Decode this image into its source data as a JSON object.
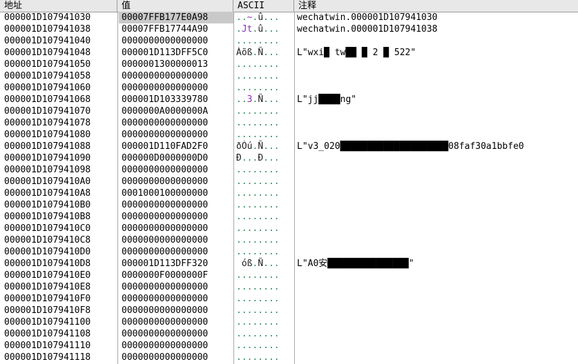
{
  "columns": {
    "address": "地址",
    "value": "值",
    "ascii": "ASCII",
    "comment": "注释"
  },
  "rows": [
    {
      "addr": "000001D107941030",
      "val": "00007FFB177E0A98",
      "ascii": [
        {
          "t": "..",
          "c": "dot"
        },
        {
          "t": "~",
          "c": "hl"
        },
        {
          "t": ".",
          "c": "dot"
        },
        {
          "t": "û",
          "c": "plain"
        },
        {
          "t": "...",
          "c": "dot"
        }
      ],
      "comment": "wechatwin.000001D107941030",
      "selected": true
    },
    {
      "addr": "000001D107941038",
      "val": "00007FFB17744A90",
      "ascii": [
        {
          "t": ".",
          "c": "dot"
        },
        {
          "t": "Jt",
          "c": "hl"
        },
        {
          "t": ".",
          "c": "dot"
        },
        {
          "t": "û",
          "c": "plain"
        },
        {
          "t": "...",
          "c": "dot"
        }
      ],
      "comment": "wechatwin.000001D107941038"
    },
    {
      "addr": "000001D107941040",
      "val": "0000000000000000",
      "ascii": [
        {
          "t": "........",
          "c": "dot"
        }
      ],
      "comment": ""
    },
    {
      "addr": "000001D107941048",
      "val": "000001D113DFF5C0",
      "ascii": [
        {
          "t": "Àõß",
          "c": "plain"
        },
        {
          "t": ".",
          "c": "dot"
        },
        {
          "t": "Ñ",
          "c": "plain"
        },
        {
          "t": "...",
          "c": "dot"
        }
      ],
      "comment": "L\"wxi█ tw██ █ 2 █ 522\""
    },
    {
      "addr": "000001D107941050",
      "val": "0000001300000013",
      "ascii": [
        {
          "t": "........",
          "c": "dot"
        }
      ],
      "comment": ""
    },
    {
      "addr": "000001D107941058",
      "val": "0000000000000000",
      "ascii": [
        {
          "t": "........",
          "c": "dot"
        }
      ],
      "comment": ""
    },
    {
      "addr": "000001D107941060",
      "val": "0000000000000000",
      "ascii": [
        {
          "t": "........",
          "c": "dot"
        }
      ],
      "comment": ""
    },
    {
      "addr": "000001D107941068",
      "val": "000001D103339780",
      "ascii": [
        {
          "t": "..",
          "c": "dot"
        },
        {
          "t": "3",
          "c": "hl"
        },
        {
          "t": ".",
          "c": "dot"
        },
        {
          "t": "Ñ",
          "c": "plain"
        },
        {
          "t": "...",
          "c": "dot"
        }
      ],
      "comment": "L\"jj████ng\""
    },
    {
      "addr": "000001D107941070",
      "val": "0000000A0000000A",
      "ascii": [
        {
          "t": "........",
          "c": "dot"
        }
      ],
      "comment": ""
    },
    {
      "addr": "000001D107941078",
      "val": "0000000000000000",
      "ascii": [
        {
          "t": "........",
          "c": "dot"
        }
      ],
      "comment": ""
    },
    {
      "addr": "000001D107941080",
      "val": "0000000000000000",
      "ascii": [
        {
          "t": "........",
          "c": "dot"
        }
      ],
      "comment": ""
    },
    {
      "addr": "000001D107941088",
      "val": "000001D110FAD2F0",
      "ascii": [
        {
          "t": "ðÒú",
          "c": "plain"
        },
        {
          "t": ".",
          "c": "dot"
        },
        {
          "t": "Ñ",
          "c": "plain"
        },
        {
          "t": "...",
          "c": "dot"
        }
      ],
      "comment": "L\"v3_020████████████████████08faf30a1bbfe0"
    },
    {
      "addr": "000001D107941090",
      "val": "000000D0000000D0",
      "ascii": [
        {
          "t": "Ð",
          "c": "plain"
        },
        {
          "t": "...",
          "c": "dot"
        },
        {
          "t": "Ð",
          "c": "plain"
        },
        {
          "t": "...",
          "c": "dot"
        }
      ],
      "comment": ""
    },
    {
      "addr": "000001D107941098",
      "val": "0000000000000000",
      "ascii": [
        {
          "t": "........",
          "c": "dot"
        }
      ],
      "comment": ""
    },
    {
      "addr": "000001D1079410A0",
      "val": "0000000000000000",
      "ascii": [
        {
          "t": "........",
          "c": "dot"
        }
      ],
      "comment": ""
    },
    {
      "addr": "000001D1079410A8",
      "val": "0001000100000000",
      "ascii": [
        {
          "t": "........",
          "c": "dot"
        }
      ],
      "comment": ""
    },
    {
      "addr": "000001D1079410B0",
      "val": "0000000000000000",
      "ascii": [
        {
          "t": "........",
          "c": "dot"
        }
      ],
      "comment": ""
    },
    {
      "addr": "000001D1079410B8",
      "val": "0000000000000000",
      "ascii": [
        {
          "t": "........",
          "c": "dot"
        }
      ],
      "comment": ""
    },
    {
      "addr": "000001D1079410C0",
      "val": "0000000000000000",
      "ascii": [
        {
          "t": "........",
          "c": "dot"
        }
      ],
      "comment": ""
    },
    {
      "addr": "000001D1079410C8",
      "val": "0000000000000000",
      "ascii": [
        {
          "t": "........",
          "c": "dot"
        }
      ],
      "comment": ""
    },
    {
      "addr": "000001D1079410D0",
      "val": "0000000000000000",
      "ascii": [
        {
          "t": "........",
          "c": "dot"
        }
      ],
      "comment": ""
    },
    {
      "addr": "000001D1079410D8",
      "val": "000001D113DFF320",
      "ascii": [
        {
          "t": " óß",
          "c": "plain"
        },
        {
          "t": ".",
          "c": "dot"
        },
        {
          "t": "Ñ",
          "c": "plain"
        },
        {
          "t": "...",
          "c": "dot"
        }
      ],
      "comment": "L\"A0安███████████████\""
    },
    {
      "addr": "000001D1079410E0",
      "val": "0000000F0000000F",
      "ascii": [
        {
          "t": "........",
          "c": "dot"
        }
      ],
      "comment": ""
    },
    {
      "addr": "000001D1079410E8",
      "val": "0000000000000000",
      "ascii": [
        {
          "t": "........",
          "c": "dot"
        }
      ],
      "comment": ""
    },
    {
      "addr": "000001D1079410F0",
      "val": "0000000000000000",
      "ascii": [
        {
          "t": "........",
          "c": "dot"
        }
      ],
      "comment": ""
    },
    {
      "addr": "000001D1079410F8",
      "val": "0000000000000000",
      "ascii": [
        {
          "t": "........",
          "c": "dot"
        }
      ],
      "comment": ""
    },
    {
      "addr": "000001D107941100",
      "val": "0000000000000000",
      "ascii": [
        {
          "t": "........",
          "c": "dot"
        }
      ],
      "comment": ""
    },
    {
      "addr": "000001D107941108",
      "val": "0000000000000000",
      "ascii": [
        {
          "t": "........",
          "c": "dot"
        }
      ],
      "comment": ""
    },
    {
      "addr": "000001D107941110",
      "val": "0000000000000000",
      "ascii": [
        {
          "t": "........",
          "c": "dot"
        }
      ],
      "comment": ""
    },
    {
      "addr": "000001D107941118",
      "val": "0000000000000000",
      "ascii": [
        {
          "t": "........",
          "c": "dot"
        }
      ],
      "comment": ""
    }
  ]
}
